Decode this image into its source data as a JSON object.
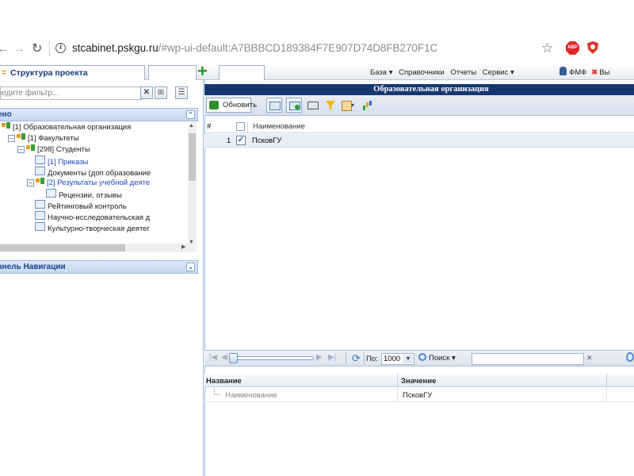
{
  "browser": {
    "url_host": "stcabinet.pskgu.ru",
    "url_rest": "/#wp-ui-default:A7BBBCD189384F7E907D74D8FB270F1C"
  },
  "appbar": {
    "structure_tab": "Структура проекта",
    "menu": [
      "База ▾",
      "Справочники",
      "Отчеты",
      "Сервис ▾"
    ],
    "user": "ФМФ",
    "logout": "Вы"
  },
  "left": {
    "filter_placeholder": "ведите фильтр...",
    "panel1_title": "ено",
    "panel2_title": "анель Навигации",
    "tree": [
      {
        "label": "[1] Образовательная организация"
      },
      {
        "label": "[1] Факультеты"
      },
      {
        "label": "[298] Студенты"
      },
      {
        "label": "[1] Приказы"
      },
      {
        "label": "Документы (доп образование"
      },
      {
        "label": "[2] Результаты учебной деяте"
      },
      {
        "label": "Рецензии, отзывы"
      },
      {
        "label": "Рейтинговый контроль"
      },
      {
        "label": "Научно-исследовательская д"
      },
      {
        "label": "Культурно-творческая деятег"
      }
    ]
  },
  "right": {
    "title": "Образовательная организация",
    "refresh_label": "Обновить",
    "grid": {
      "col_num": "#",
      "col_name": "Наименование",
      "rows": [
        {
          "num": "1",
          "name": "ПсковГУ",
          "checked": true
        }
      ]
    },
    "pager": {
      "page_size_label": "По:",
      "page_size": "1000",
      "search_label": "Поиск ▾",
      "clear": "✕"
    },
    "props": {
      "col_name": "Название",
      "col_value": "Значение",
      "rows": [
        {
          "name": "Наименование",
          "value": "ПсковГУ"
        }
      ]
    }
  },
  "colors": {
    "title_bar": "#16366f",
    "panel_header": "#c6d7ee",
    "link_blue": "#1e45c8",
    "add_green": "#1d9a1d"
  }
}
